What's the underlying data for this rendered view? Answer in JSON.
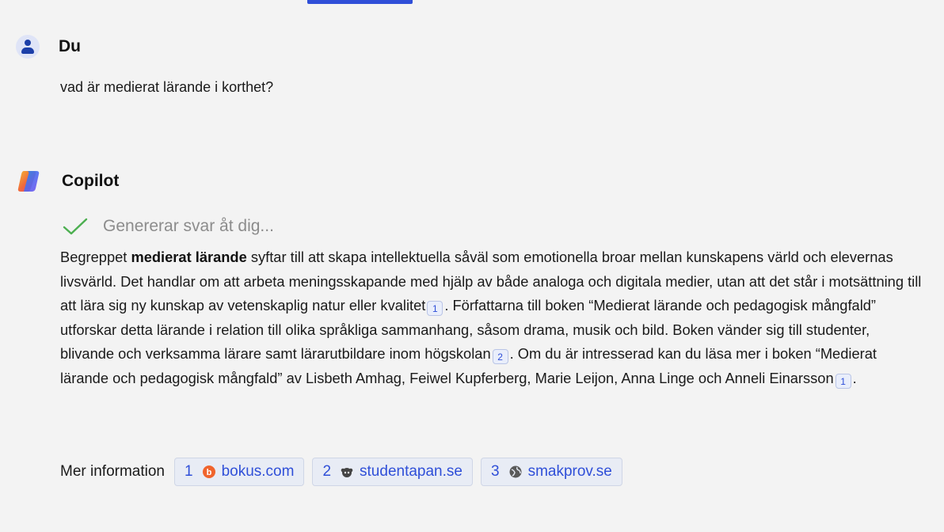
{
  "user_message": {
    "author": "Du",
    "text": "vad är medierat lärande i korthet?"
  },
  "copilot_message": {
    "author": "Copilot",
    "status": "Genererar svar åt dig...",
    "answer": {
      "p1": "Begreppet ",
      "bold": "medierat lärande",
      "p2": " syftar till att skapa intellektuella såväl som emotionella broar mellan kunskapens värld och elevernas livsvärld. Det handlar om att arbeta meningsskapande med hjälp av både analoga och digitala medier, utan att det står i motsättning till att lära sig ny kunskap av vetenskaplig natur eller kvalitet",
      "c1": "1",
      "p3": ". Författarna till boken “Medierat lärande och pedagogisk mångfald” utforskar detta lärande i relation till olika språkliga sammanhang, såsom drama, musik och bild. Boken vänder sig till studenter, blivande och verksamma lärare samt lärarutbildare inom högskolan",
      "c2": "2",
      "p4": ". Om du är intresserad kan du läsa mer i boken “Medierat lärande och pedagogisk mångfald” av Lisbeth Amhag, Feiwel Kupferberg, Marie Leijon, Anna Linge och Anneli Einarsson",
      "c3": "1",
      "p5": "."
    },
    "more_info_label": "Mer information",
    "sources": [
      {
        "num": "1",
        "name": "bokus.com",
        "icon": "bokus-icon",
        "color": "#f0642d"
      },
      {
        "num": "2",
        "name": "studentapan.se",
        "icon": "studentapan-icon",
        "color": "#333333"
      },
      {
        "num": "3",
        "name": "smakprov.se",
        "icon": "globe-icon",
        "color": "#555555"
      }
    ]
  },
  "colors": {
    "accent": "#2f4fd8",
    "check": "#4caf50",
    "background": "#f3f3f3"
  }
}
